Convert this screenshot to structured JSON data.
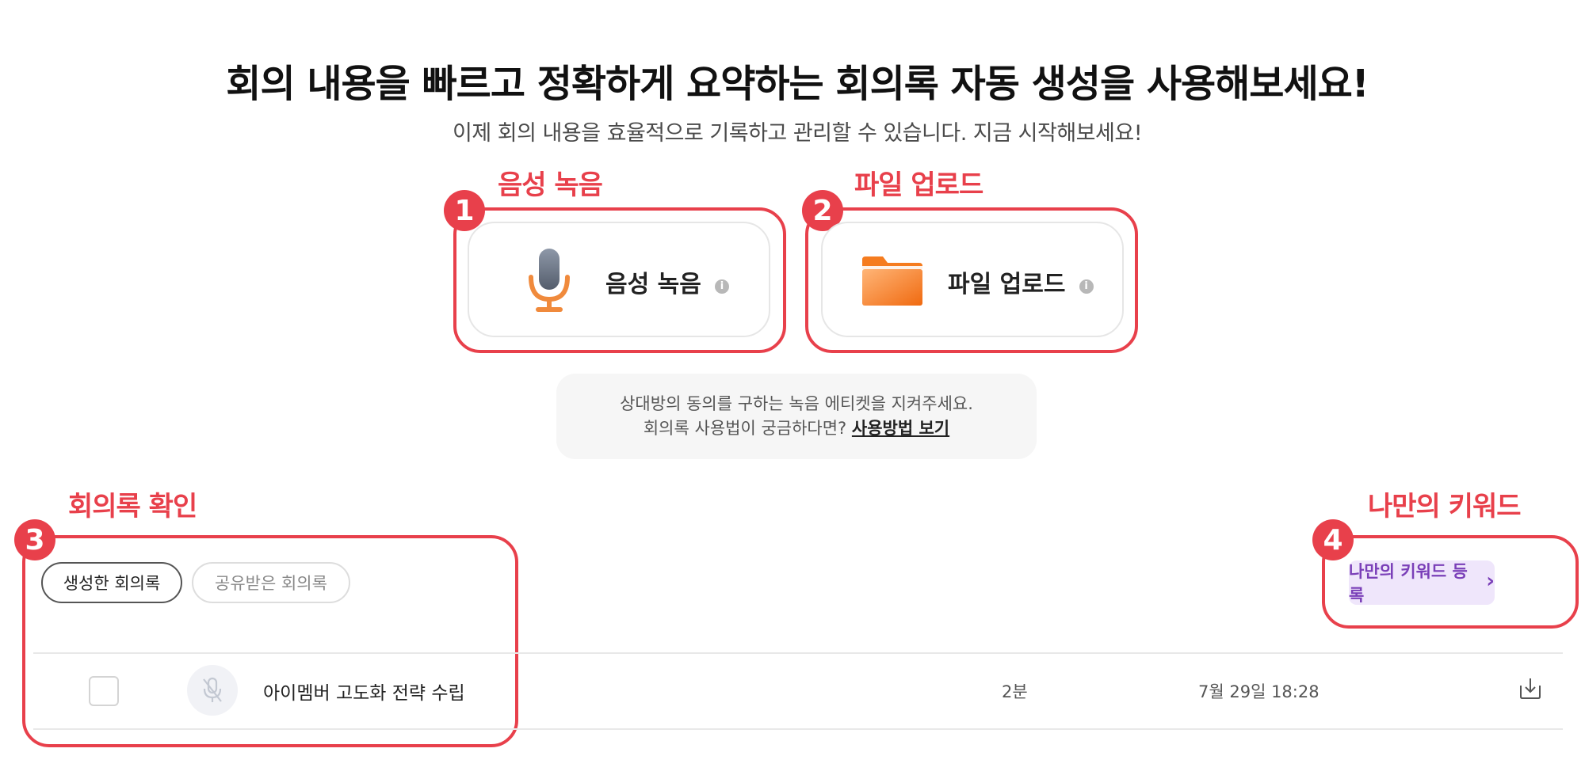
{
  "header": {
    "title": "회의 내용을 빠르고 정확하게 요약하는 회의록 자동 생성을 사용해보세요!",
    "subtitle": "이제 회의 내용을 효율적으로 기록하고 관리할 수 있습니다. 지금 시작해보세요!"
  },
  "callouts": [
    {
      "number": "1",
      "label": "음성 녹음"
    },
    {
      "number": "2",
      "label": "파일 업로드"
    },
    {
      "number": "3",
      "label": "회의록 확인"
    },
    {
      "number": "4",
      "label": "나만의 키워드"
    }
  ],
  "actions": {
    "record": {
      "label": "음성 녹음",
      "icon": "microphone-icon"
    },
    "upload": {
      "label": "파일 업로드",
      "icon": "folder-icon"
    },
    "info_glyph": "i"
  },
  "notice": {
    "line1": "상대방의 동의를 구하는 녹음 에티켓을 지켜주세요.",
    "line2_prefix": "회의록 사용법이 궁금하다면?",
    "link": "사용방법 보기"
  },
  "tabs": [
    {
      "label": "생성한 회의록",
      "active": true
    },
    {
      "label": "공유받은 회의록",
      "active": false
    }
  ],
  "keyword_button": {
    "label": "나만의 키워드 등록",
    "chevron": "›"
  },
  "records": [
    {
      "title": "아이멤버 고도화 전략 수립",
      "duration": "2분",
      "date": "7월 29일 18:28",
      "status_icon": "mic-off-icon",
      "action_icon": "download-icon"
    }
  ],
  "colors": {
    "accent_red": "#e8404b",
    "keyword_bg": "#efe6fb",
    "keyword_text": "#7a3fb8",
    "mic_orange": "#f08a3c",
    "folder_orange": "#f57c1f"
  }
}
